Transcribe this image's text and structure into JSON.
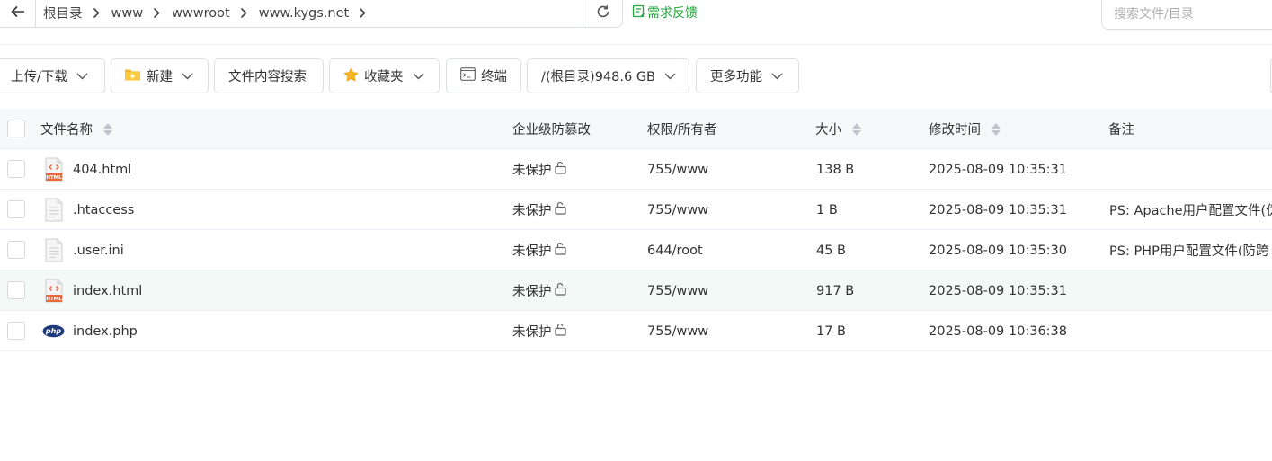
{
  "pathbar": {
    "crumbs": [
      "根目录",
      "www",
      "wwwroot",
      "www.kygs.net"
    ],
    "feedback_label": "需求反馈",
    "search_placeholder": "搜索文件/目录"
  },
  "toolbar": {
    "upload_download": "上传/下载",
    "new": "新建",
    "content_search": "文件内容搜索",
    "favorites": "收藏夹",
    "terminal": "终端",
    "disk": "/(根目录)948.6 GB",
    "more": "更多功能"
  },
  "table": {
    "headers": {
      "name": "文件名称",
      "protect": "企业级防篡改",
      "perm": "权限/所有者",
      "size": "大小",
      "mtime": "修改时间",
      "note": "备注"
    },
    "rows": [
      {
        "name": "404.html",
        "icon": "html-file-icon",
        "protect": "未保护",
        "perm": "755/www",
        "size": "138 B",
        "mtime": "2025-08-09 10:35:31",
        "note": ""
      },
      {
        "name": ".htaccess",
        "icon": "text-file-icon",
        "protect": "未保护",
        "perm": "755/www",
        "size": "1 B",
        "mtime": "2025-08-09 10:35:31",
        "note": "PS: Apache用户配置文件(伪"
      },
      {
        "name": ".user.ini",
        "icon": "text-file-icon",
        "protect": "未保护",
        "perm": "644/root",
        "size": "45 B",
        "mtime": "2025-08-09 10:35:30",
        "note": "PS: PHP用户配置文件(防跨"
      },
      {
        "name": "index.html",
        "icon": "html-file-icon",
        "protect": "未保护",
        "perm": "755/www",
        "size": "917 B",
        "mtime": "2025-08-09 10:35:31",
        "note": ""
      },
      {
        "name": "index.php",
        "icon": "php-file-icon",
        "protect": "未保护",
        "perm": "755/www",
        "size": "17 B",
        "mtime": "2025-08-09 10:36:38",
        "note": ""
      }
    ]
  },
  "colors": {
    "accent": "#20a53a",
    "border": "#dcdfe6",
    "header_bg": "#f7f8fa",
    "hover_row": "#f2f9f7",
    "html_icon": "#e8693a",
    "php_icon": "#1f3a7a"
  }
}
